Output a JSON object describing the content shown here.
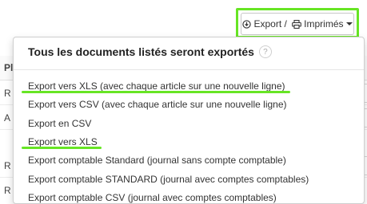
{
  "toolbar": {
    "export_label": "Export / ",
    "print_label": "Imprimés"
  },
  "background": {
    "header_letter": "Pl",
    "rows": [
      "R",
      "A",
      "R",
      "R"
    ]
  },
  "dropdown": {
    "title": "Tous les documents listés seront exportés",
    "help": "?",
    "items": [
      "Export vers XLS (avec chaque article sur une nouvelle ligne)",
      "Export vers CSV (avec chaque article sur une nouvelle ligne)",
      "Export en CSV",
      "Export vers XLS",
      "Export comptable Standard (journal sans compte comptable)",
      "Export comptable STANDARD (journal avec comptes comptables)",
      "Export comptable CSV (journal avec comptes comptables)"
    ]
  },
  "colors": {
    "highlight": "#67e524"
  }
}
